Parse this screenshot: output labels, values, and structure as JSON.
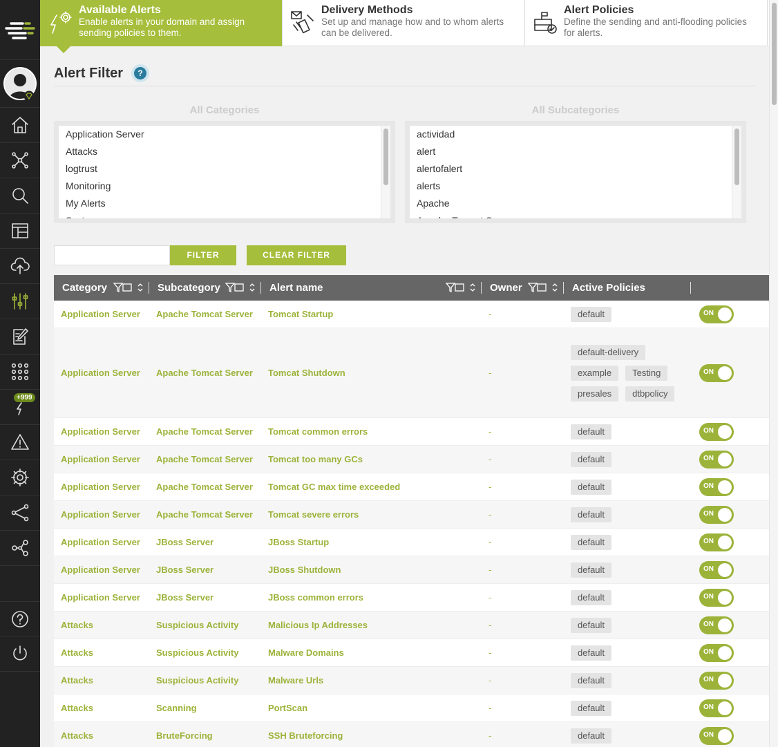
{
  "tabs": [
    {
      "title": "Available Alerts",
      "desc": "Enable alerts in your domain and assign sending policies to them."
    },
    {
      "title": "Delivery Methods",
      "desc": "Set up and manage how and to whom alerts can be delivered."
    },
    {
      "title": "Alert Policies",
      "desc": "Define the sending and anti-flooding policies for alerts."
    }
  ],
  "sidebar": {
    "badge": "+999"
  },
  "page": {
    "title": "Alert Filter",
    "help": "?"
  },
  "categories": {
    "header": "All Categories",
    "items": [
      "Application Server",
      "Attacks",
      "logtrust",
      "Monitoring",
      "My Alerts",
      "System"
    ]
  },
  "subcategories": {
    "header": "All Subcategories",
    "items": [
      "actividad",
      "alert",
      "alertofalert",
      "alerts",
      "Apache",
      "Apache Tomcat Server"
    ]
  },
  "filter": {
    "placeholder": "",
    "value": "",
    "filter_label": "FILTER",
    "clear_label": "CLEAR FILTER"
  },
  "table": {
    "headers": [
      "Category",
      "Subcategory",
      "Alert name",
      "Owner",
      "Active Policies",
      ""
    ],
    "toggle_label": "ON",
    "rows": [
      {
        "category": "Application Server",
        "subcategory": "Apache Tomcat Server",
        "name": "Tomcat Startup",
        "owner": "-",
        "policies": [
          "default"
        ]
      },
      {
        "category": "Application Server",
        "subcategory": "Apache Tomcat Server",
        "name": "Tomcat Shutdown",
        "owner": "-",
        "policies": [
          "default-delivery",
          "example",
          "Testing",
          "presales",
          "dtbpolicy"
        ]
      },
      {
        "category": "Application Server",
        "subcategory": "Apache Tomcat Server",
        "name": "Tomcat common errors",
        "owner": "-",
        "policies": [
          "default"
        ]
      },
      {
        "category": "Application Server",
        "subcategory": "Apache Tomcat Server",
        "name": "Tomcat too many GCs",
        "owner": "-",
        "policies": [
          "default"
        ]
      },
      {
        "category": "Application Server",
        "subcategory": "Apache Tomcat Server",
        "name": "Tomcat GC max time exceeded",
        "owner": "-",
        "policies": [
          "default"
        ]
      },
      {
        "category": "Application Server",
        "subcategory": "Apache Tomcat Server",
        "name": "Tomcat severe errors",
        "owner": "-",
        "policies": [
          "default"
        ]
      },
      {
        "category": "Application Server",
        "subcategory": "JBoss Server",
        "name": "JBoss Startup",
        "owner": "-",
        "policies": [
          "default"
        ]
      },
      {
        "category": "Application Server",
        "subcategory": "JBoss Server",
        "name": "JBoss Shutdown",
        "owner": "-",
        "policies": [
          "default"
        ]
      },
      {
        "category": "Application Server",
        "subcategory": "JBoss Server",
        "name": "JBoss common errors",
        "owner": "-",
        "policies": [
          "default"
        ]
      },
      {
        "category": "Attacks",
        "subcategory": "Suspicious Activity",
        "name": "Malicious Ip Addresses",
        "owner": "-",
        "policies": [
          "default"
        ]
      },
      {
        "category": "Attacks",
        "subcategory": "Suspicious Activity",
        "name": "Malware Domains",
        "owner": "-",
        "policies": [
          "default"
        ]
      },
      {
        "category": "Attacks",
        "subcategory": "Suspicious Activity",
        "name": "Malware Urls",
        "owner": "-",
        "policies": [
          "default"
        ]
      },
      {
        "category": "Attacks",
        "subcategory": "Scanning",
        "name": "PortScan",
        "owner": "-",
        "policies": [
          "default"
        ]
      },
      {
        "category": "Attacks",
        "subcategory": "BruteForcing",
        "name": "SSH Bruteforcing",
        "owner": "-",
        "policies": [
          "default"
        ]
      }
    ]
  },
  "colors": {
    "accent": "#a5be3b",
    "sidebar": "#222222",
    "header": "#666666"
  }
}
